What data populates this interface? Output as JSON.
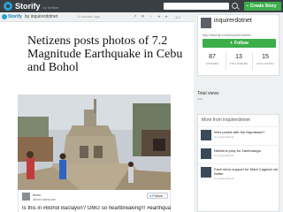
{
  "topbar": {
    "brand": "Storify",
    "brand_sub": "by livefyre",
    "search_icon": "search-icon",
    "create_story": "Create Story",
    "create_icon": "plus-icon",
    "colors": {
      "bar": "#3a3f44",
      "accent": "#26a2d6",
      "create": "#3cae4a"
    }
  },
  "storybar": {
    "brand": "Storify",
    "by": "by inquirerdotnet",
    "time": "6 minutes ago",
    "pages": "1/3"
  },
  "story": {
    "headline": "Netizens posts photos of 7.2 Magnitude Earthquake in Cebu and Bohol",
    "tweet": {
      "name": "Imon",
      "handle": "@mindanaoan",
      "follow": "Follow",
      "text": "Is this in #Bohol Baclayon? OMG so heartbreaking!!! #earthquake"
    }
  },
  "sidebar": {
    "profile": {
      "name": "inquirerdotnet",
      "url": "http://storify.com/inquirerdotnet",
      "follow": "Follow",
      "stats": [
        {
          "value": "87",
          "label": "STORIES"
        },
        {
          "value": "13",
          "label": "FOLLOWERS"
        },
        {
          "value": "15",
          "label": "FOLLOWING"
        }
      ]
    },
    "total_views": {
      "label": "Total views",
      "sub": "older"
    },
    "more": {
      "title": "More from inquirerdotnet",
      "items": [
        {
          "title": "Who posed with the Napoleses?",
          "by": "by inquirerdotnet"
        },
        {
          "title": "Netizens pray for Zamboanga",
          "by": "by inquirerdotnet"
        },
        {
          "title": "Fans show support for Mark Caguioa via twitter",
          "by": "by inquirerdotnet"
        }
      ]
    },
    "colors": {
      "follow": "#3cae4a"
    }
  }
}
